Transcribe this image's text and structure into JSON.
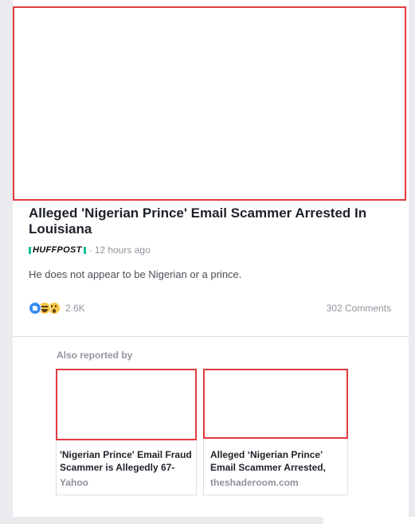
{
  "article": {
    "headline": "Alleged 'Nigerian Prince' Email Scammer Arrested In Louisiana",
    "source_logo_text": "HUFFPOST",
    "source_separator": "·",
    "timestamp": "12 hours ago",
    "description": "He does not appear to be Nigerian or a prince.",
    "reactions": {
      "icons": [
        "like-icon",
        "haha-icon",
        "wow-icon"
      ],
      "count": "2.6K"
    },
    "comments_label": "302 Comments"
  },
  "related": {
    "heading": "Also reported by",
    "items": [
      {
        "title": "'Nigerian Prince' Email Fraud Scammer is Allegedly 67-",
        "source": "Yahoo"
      },
      {
        "title": "Alleged ‘Nigerian Prince’ Email Scammer Arrested,",
        "source": "theshaderoom.com"
      }
    ]
  },
  "colors": {
    "background": "#e9ebee",
    "card": "#ffffff",
    "placeholder_border": "#e03a3e",
    "huffpost_accent": "#0dbe98",
    "like_blue": "#3b8af0",
    "emoji_yellow": "#f7c645"
  }
}
